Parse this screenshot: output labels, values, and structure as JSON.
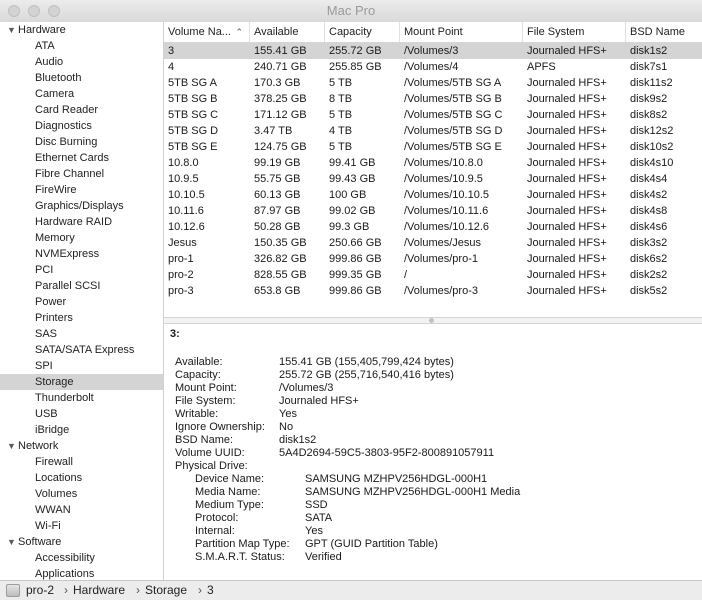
{
  "window": {
    "title": "Mac Pro"
  },
  "sidebar": {
    "sections": [
      {
        "label": "Hardware",
        "items": [
          "ATA",
          "Audio",
          "Bluetooth",
          "Camera",
          "Card Reader",
          "Diagnostics",
          "Disc Burning",
          "Ethernet Cards",
          "Fibre Channel",
          "FireWire",
          "Graphics/Displays",
          "Hardware RAID",
          "Memory",
          "NVMExpress",
          "PCI",
          "Parallel SCSI",
          "Power",
          "Printers",
          "SAS",
          "SATA/SATA Express",
          "SPI",
          "Storage",
          "Thunderbolt",
          "USB",
          "iBridge"
        ]
      },
      {
        "label": "Network",
        "items": [
          "Firewall",
          "Locations",
          "Volumes",
          "WWAN",
          "Wi-Fi"
        ]
      },
      {
        "label": "Software",
        "items": [
          "Accessibility",
          "Applications"
        ]
      }
    ],
    "selected_item": "Storage"
  },
  "table": {
    "columns": [
      "Volume Na...",
      "Available",
      "Capacity",
      "Mount Point",
      "File System",
      "BSD Name"
    ],
    "rows": [
      [
        "3",
        "155.41 GB",
        "255.72 GB",
        "/Volumes/3",
        "Journaled HFS+",
        "disk1s2"
      ],
      [
        "4",
        "240.71 GB",
        "255.85 GB",
        "/Volumes/4",
        "APFS",
        "disk7s1"
      ],
      [
        "5TB SG A",
        "170.3 GB",
        "5 TB",
        "/Volumes/5TB SG A",
        "Journaled HFS+",
        "disk11s2"
      ],
      [
        "5TB SG B",
        "378.25 GB",
        "8 TB",
        "/Volumes/5TB SG B",
        "Journaled HFS+",
        "disk9s2"
      ],
      [
        "5TB SG C",
        "171.12 GB",
        "5 TB",
        "/Volumes/5TB SG C",
        "Journaled HFS+",
        "disk8s2"
      ],
      [
        "5TB SG D",
        "3.47 TB",
        "4 TB",
        "/Volumes/5TB SG D",
        "Journaled HFS+",
        "disk12s2"
      ],
      [
        "5TB SG E",
        "124.75 GB",
        "5 TB",
        "/Volumes/5TB SG E",
        "Journaled HFS+",
        "disk10s2"
      ],
      [
        "10.8.0",
        "99.19 GB",
        "99.41 GB",
        "/Volumes/10.8.0",
        "Journaled HFS+",
        "disk4s10"
      ],
      [
        "10.9.5",
        "55.75 GB",
        "99.43 GB",
        "/Volumes/10.9.5",
        "Journaled HFS+",
        "disk4s4"
      ],
      [
        "10.10.5",
        "60.13 GB",
        "100 GB",
        "/Volumes/10.10.5",
        "Journaled HFS+",
        "disk4s2"
      ],
      [
        "10.11.6",
        "87.97 GB",
        "99.02 GB",
        "/Volumes/10.11.6",
        "Journaled HFS+",
        "disk4s8"
      ],
      [
        "10.12.6",
        "50.28 GB",
        "99.3 GB",
        "/Volumes/10.12.6",
        "Journaled HFS+",
        "disk4s6"
      ],
      [
        "Jesus",
        "150.35 GB",
        "250.66 GB",
        "/Volumes/Jesus",
        "Journaled HFS+",
        "disk3s2"
      ],
      [
        "pro-1",
        "326.82 GB",
        "999.86 GB",
        "/Volumes/pro-1",
        "Journaled HFS+",
        "disk6s2"
      ],
      [
        "pro-2",
        "828.55 GB",
        "999.35 GB",
        "/",
        "Journaled HFS+",
        "disk2s2"
      ],
      [
        "pro-3",
        "653.8 GB",
        "999.86 GB",
        "/Volumes/pro-3",
        "Journaled HFS+",
        "disk5s2"
      ]
    ],
    "selected_row": 0
  },
  "detail": {
    "title": "3:",
    "fields": [
      {
        "key": "Available:",
        "value": "155.41 GB (155,405,799,424 bytes)"
      },
      {
        "key": "Capacity:",
        "value": "255.72 GB (255,716,540,416 bytes)"
      },
      {
        "key": "Mount Point:",
        "value": "/Volumes/3"
      },
      {
        "key": "File System:",
        "value": "Journaled HFS+"
      },
      {
        "key": "Writable:",
        "value": "Yes"
      },
      {
        "key": "Ignore Ownership:",
        "value": "No"
      },
      {
        "key": "BSD Name:",
        "value": "disk1s2"
      },
      {
        "key": "Volume UUID:",
        "value": "5A4D2694-59C5-3803-95F2-800891057911"
      },
      {
        "key": "Physical Drive:",
        "value": ""
      }
    ],
    "drive_fields": [
      {
        "key": "Device Name:",
        "value": "SAMSUNG MZHPV256HDGL-000H1"
      },
      {
        "key": "Media Name:",
        "value": "SAMSUNG MZHPV256HDGL-000H1 Media"
      },
      {
        "key": "Medium Type:",
        "value": "SSD"
      },
      {
        "key": "Protocol:",
        "value": "SATA"
      },
      {
        "key": "Internal:",
        "value": "Yes"
      },
      {
        "key": "Partition Map Type:",
        "value": "GPT (GUID Partition Table)"
      },
      {
        "key": "S.M.A.R.T. Status:",
        "value": "Verified"
      }
    ]
  },
  "breadcrumb": {
    "items": [
      "pro-2",
      "Hardware",
      "Storage",
      "3"
    ],
    "separator": "›"
  },
  "colors": {
    "selection": "#d4d4d4",
    "titlebar_text": "#9a9a9a"
  }
}
